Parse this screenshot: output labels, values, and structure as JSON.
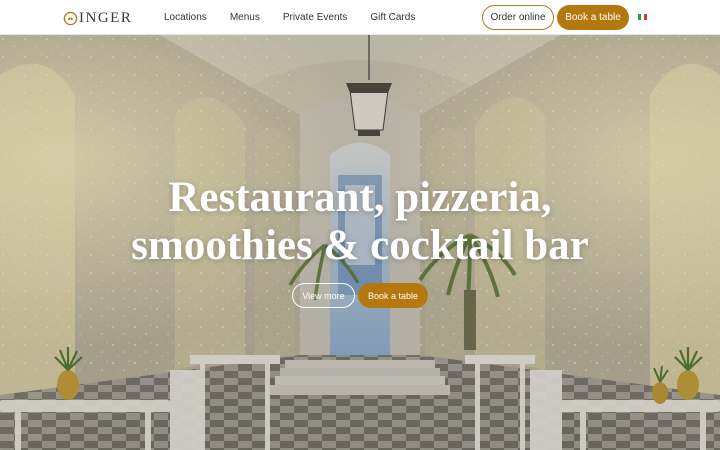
{
  "header": {
    "logo_text": "INGER",
    "nav": [
      {
        "label": "Locations"
      },
      {
        "label": "Menus"
      },
      {
        "label": "Private Events"
      },
      {
        "label": "Gift Cards"
      }
    ],
    "order_label": "Order online",
    "book_label": "Book a table",
    "flag_colors": [
      "#2e9a48",
      "#ffffff",
      "#d33a32"
    ]
  },
  "hero": {
    "title_line1": "Restaurant, pizzeria,",
    "title_line2": "smoothies & cocktail bar",
    "view_more_label": "View more",
    "book_label": "Book a table"
  },
  "colors": {
    "accent": "#b5780f",
    "header_bg": "#ffffff",
    "text": "#333333"
  }
}
